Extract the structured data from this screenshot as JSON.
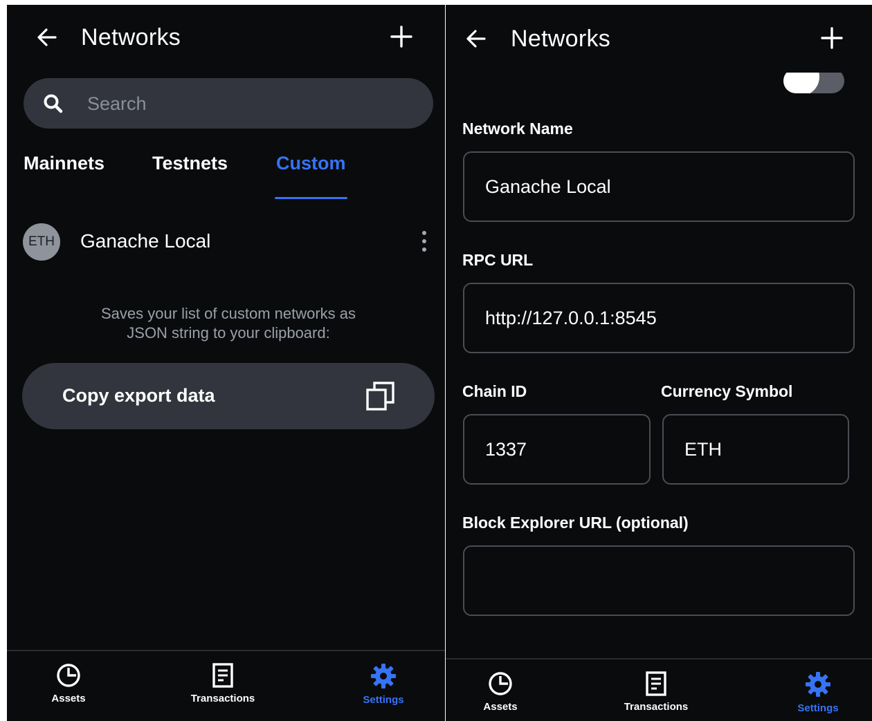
{
  "left": {
    "header": {
      "title": "Networks",
      "back_icon": "arrow-left-icon",
      "add_icon": "plus-icon"
    },
    "search": {
      "placeholder": "Search",
      "value": ""
    },
    "tabs": [
      {
        "label": "Mainnets",
        "active": false
      },
      {
        "label": "Testnets",
        "active": false
      },
      {
        "label": "Custom",
        "active": true
      }
    ],
    "networks": [
      {
        "avatar_text": "ETH",
        "name": "Ganache Local"
      }
    ],
    "export": {
      "description_line1": "Saves your list of custom networks as",
      "description_line2": "JSON string to your clipboard:",
      "button_label": "Copy export data"
    },
    "nav": [
      {
        "label": "Assets",
        "icon": "pie-chart-icon",
        "active": false
      },
      {
        "label": "Transactions",
        "icon": "receipt-icon",
        "active": false
      },
      {
        "label": "Settings",
        "icon": "gear-icon",
        "active": true
      }
    ]
  },
  "right": {
    "header": {
      "title": "Networks"
    },
    "form": {
      "network_name_label": "Network Name",
      "network_name_value": "Ganache Local",
      "rpc_url_label": "RPC URL",
      "rpc_url_value": "http://127.0.0.1:8545",
      "chain_id_label": "Chain ID",
      "chain_id_value": "1337",
      "currency_symbol_label": "Currency Symbol",
      "currency_symbol_value": "ETH",
      "block_explorer_label": "Block Explorer URL (optional)",
      "block_explorer_value": ""
    },
    "nav": [
      {
        "label": "Assets"
      },
      {
        "label": "Transactions"
      },
      {
        "label": "Settings"
      }
    ]
  },
  "colors": {
    "accent": "#3773f5",
    "background": "#0a0b0d",
    "surface": "#32353d",
    "muted_text": "#9aa0aa"
  }
}
